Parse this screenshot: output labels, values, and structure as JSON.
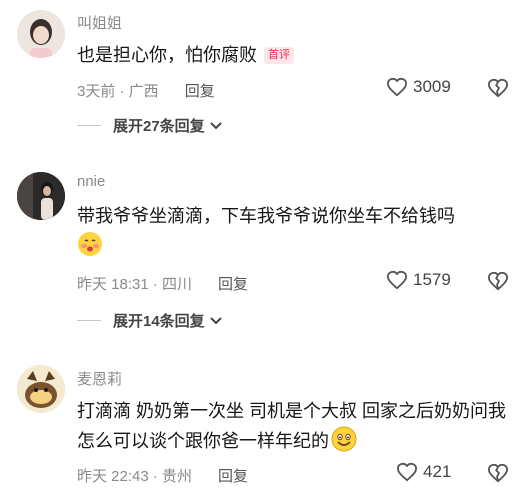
{
  "comments": [
    {
      "username": "叫姐姐",
      "text": "也是担心你，怕你腐败",
      "tag": "首评",
      "meta": "3天前 · 广西",
      "reply": "回复",
      "likes": "3009",
      "expand": "展开27条回复"
    },
    {
      "username": "nnie",
      "text": "带我爷爷坐滴滴，下车我爷爷说你坐车不给钱吗",
      "meta": "昨天 18:31 · 四川",
      "reply": "回复",
      "likes": "1579",
      "expand": "展开14条回复"
    },
    {
      "username": "麦恩莉",
      "text": "打滴滴 奶奶第一次坐 司机是个大叔 回家之后奶奶问我怎么可以谈个跟你爸一样年纪的",
      "meta": "昨天 22:43 · 贵州",
      "reply": "回复",
      "likes": "421"
    }
  ],
  "icons": {
    "like": "heart-outline-icon",
    "dislike": "broken-heart-icon",
    "expand": "chevron-down-icon",
    "emoji1": "blushing-face-emoji",
    "emoji2": "smiling-face-emoji"
  }
}
